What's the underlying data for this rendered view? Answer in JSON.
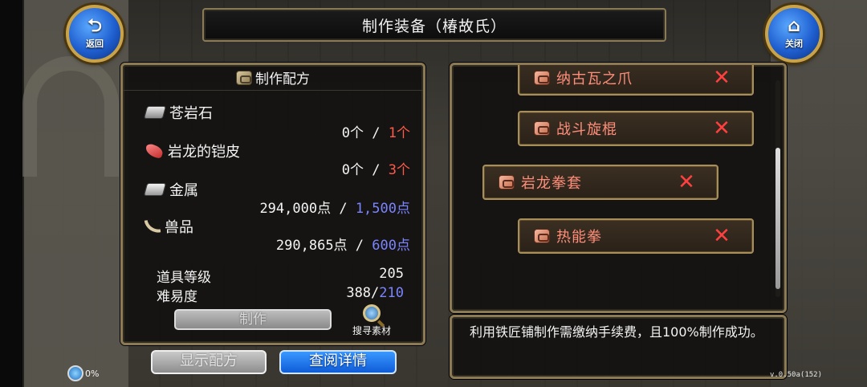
{
  "title": "制作装备（椿故氏）",
  "buttons": {
    "back": "返回",
    "close": "关闭",
    "make": "制作",
    "search_materials": "搜寻素材",
    "show_recipe": "显示配方",
    "view_details": "查阅详情"
  },
  "recipe": {
    "header": "制作配方",
    "materials": [
      {
        "name": "苍岩石",
        "have": "0个",
        "sep": " / ",
        "need": "1个",
        "icon": "stone-icon"
      },
      {
        "name": "岩龙的铠皮",
        "have": "0个",
        "sep": " / ",
        "need": "3个",
        "icon": "hide-icon"
      },
      {
        "name": "金属",
        "have": "294,000点",
        "sep": " / ",
        "need": "1,500点",
        "icon": "metal-icon"
      },
      {
        "name": "兽品",
        "have": "290,865点",
        "sep": " / ",
        "need": "600点",
        "icon": "claw-icon"
      }
    ],
    "item_level_label": "道具等级",
    "item_level_value": "205",
    "difficulty_label": "难易度",
    "difficulty_value": "388/",
    "difficulty_target": "210"
  },
  "item_list": [
    {
      "name": "纳古瓦之爪",
      "remove": "✕"
    },
    {
      "name": "战斗旋棍",
      "remove": "✕"
    },
    {
      "name": "岩龙拳套",
      "remove": "✕"
    },
    {
      "name": "热能拳",
      "remove": "✕"
    }
  ],
  "info_text": "利用铁匠铺制作需缴纳手续费，且100%制作成功。",
  "status": {
    "percent": "0%"
  },
  "version": "v.0.50a(152)",
  "colors": {
    "need_red": "#ff5a4a",
    "need_blue": "#7b84ff",
    "item_text": "#ff8e7a",
    "remove_x": "#ff4040",
    "accent_blue": "#1f5fd0",
    "frame_gold": "#8c7a55"
  }
}
